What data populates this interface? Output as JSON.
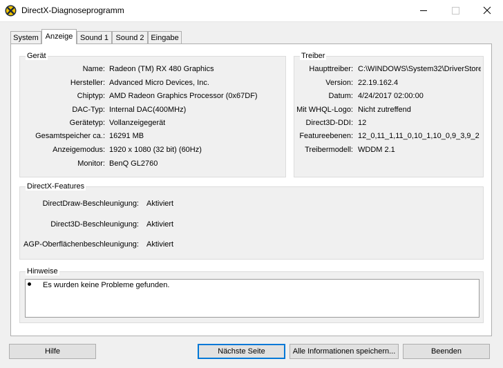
{
  "window": {
    "title": "DirectX-Diagnoseprogramm",
    "icon": "directx-icon",
    "controls": [
      "minimize-icon",
      "maximize-icon",
      "close-icon"
    ]
  },
  "tabs": [
    {
      "label": "System",
      "active": false
    },
    {
      "label": "Anzeige",
      "active": true
    },
    {
      "label": "Sound 1",
      "active": false
    },
    {
      "label": "Sound 2",
      "active": false
    },
    {
      "label": "Eingabe",
      "active": false
    }
  ],
  "device": {
    "title": "Gerät",
    "rows": [
      {
        "label": "Name:",
        "value": "Radeon (TM) RX 480 Graphics"
      },
      {
        "label": "Hersteller:",
        "value": "Advanced Micro Devices, Inc."
      },
      {
        "label": "Chiptyp:",
        "value": "AMD Radeon Graphics Processor (0x67DF)"
      },
      {
        "label": "DAC-Typ:",
        "value": "Internal DAC(400MHz)"
      },
      {
        "label": "Gerätetyp:",
        "value": "Vollanzeigegerät"
      },
      {
        "label": "Gesamtspeicher ca.:",
        "value": "16291 MB"
      },
      {
        "label": "Anzeigemodus:",
        "value": "1920 x 1080 (32 bit) (60Hz)"
      },
      {
        "label": "Monitor:",
        "value": "BenQ GL2760"
      }
    ]
  },
  "driver": {
    "title": "Treiber",
    "rows": [
      {
        "label": "Haupttreiber:",
        "value": "C:\\WINDOWS\\System32\\DriverStore"
      },
      {
        "label": "Version:",
        "value": "22.19.162.4"
      },
      {
        "label": "Datum:",
        "value": "4/24/2017 02:00:00"
      },
      {
        "label": "Mit WHQL-Logo:",
        "value": "Nicht zutreffend"
      },
      {
        "label": "Direct3D-DDI:",
        "value": "12"
      },
      {
        "label": "Featureebenen:",
        "value": "12_0,11_1,11_0,10_1,10_0,9_3,9_2"
      },
      {
        "label": "Treibermodell:",
        "value": "WDDM 2.1"
      }
    ]
  },
  "features": {
    "title": "DirectX-Features",
    "rows": [
      {
        "label": "DirectDraw-Beschleunigung:",
        "value": "Aktiviert"
      },
      {
        "label": "Direct3D-Beschleunigung:",
        "value": "Aktiviert"
      },
      {
        "label": "AGP-Oberflächenbeschleunigung:",
        "value": "Aktiviert"
      }
    ]
  },
  "notes": {
    "title": "Hinweise",
    "items": [
      "Es wurden keine Probleme gefunden."
    ]
  },
  "buttons": {
    "help": "Hilfe",
    "next_page": "Nächste Seite",
    "save_all": "Alle Informationen speichern...",
    "exit": "Beenden"
  }
}
